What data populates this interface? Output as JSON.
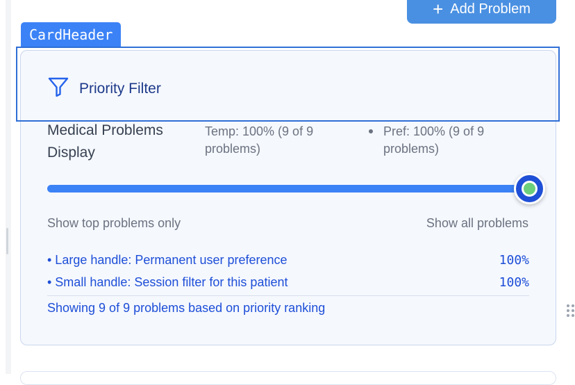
{
  "header": {
    "add_button_label": "Add Problem",
    "add_button_icon": "plus-icon"
  },
  "overlay": {
    "tag_label": "CardHeader",
    "highlight_color": "#2f6fd6"
  },
  "card": {
    "title": "Priority Filter",
    "title_icon": "filter-icon",
    "section_title": "Medical Problems Display",
    "temp_stat": "Temp: 100% (9 of 9 problems)",
    "pref_stat": "Pref: 100% (9 of 9 problems)",
    "slider": {
      "permanent_value": 1.0,
      "session_value": 1.0,
      "min_label": "Show top problems only",
      "max_label": "Show all problems"
    },
    "legend": [
      {
        "label": "• Large handle: Permanent user preference",
        "value": "100%"
      },
      {
        "label": "• Small handle: Session filter for this patient",
        "value": "100%"
      }
    ],
    "summary": "Showing 9 of 9 problems based on priority ranking"
  },
  "colors": {
    "accent": "#3b82f6",
    "handle_large": "#1e4fd6",
    "handle_small": "#6ccf7c",
    "title_text": "#1e3a8a"
  }
}
